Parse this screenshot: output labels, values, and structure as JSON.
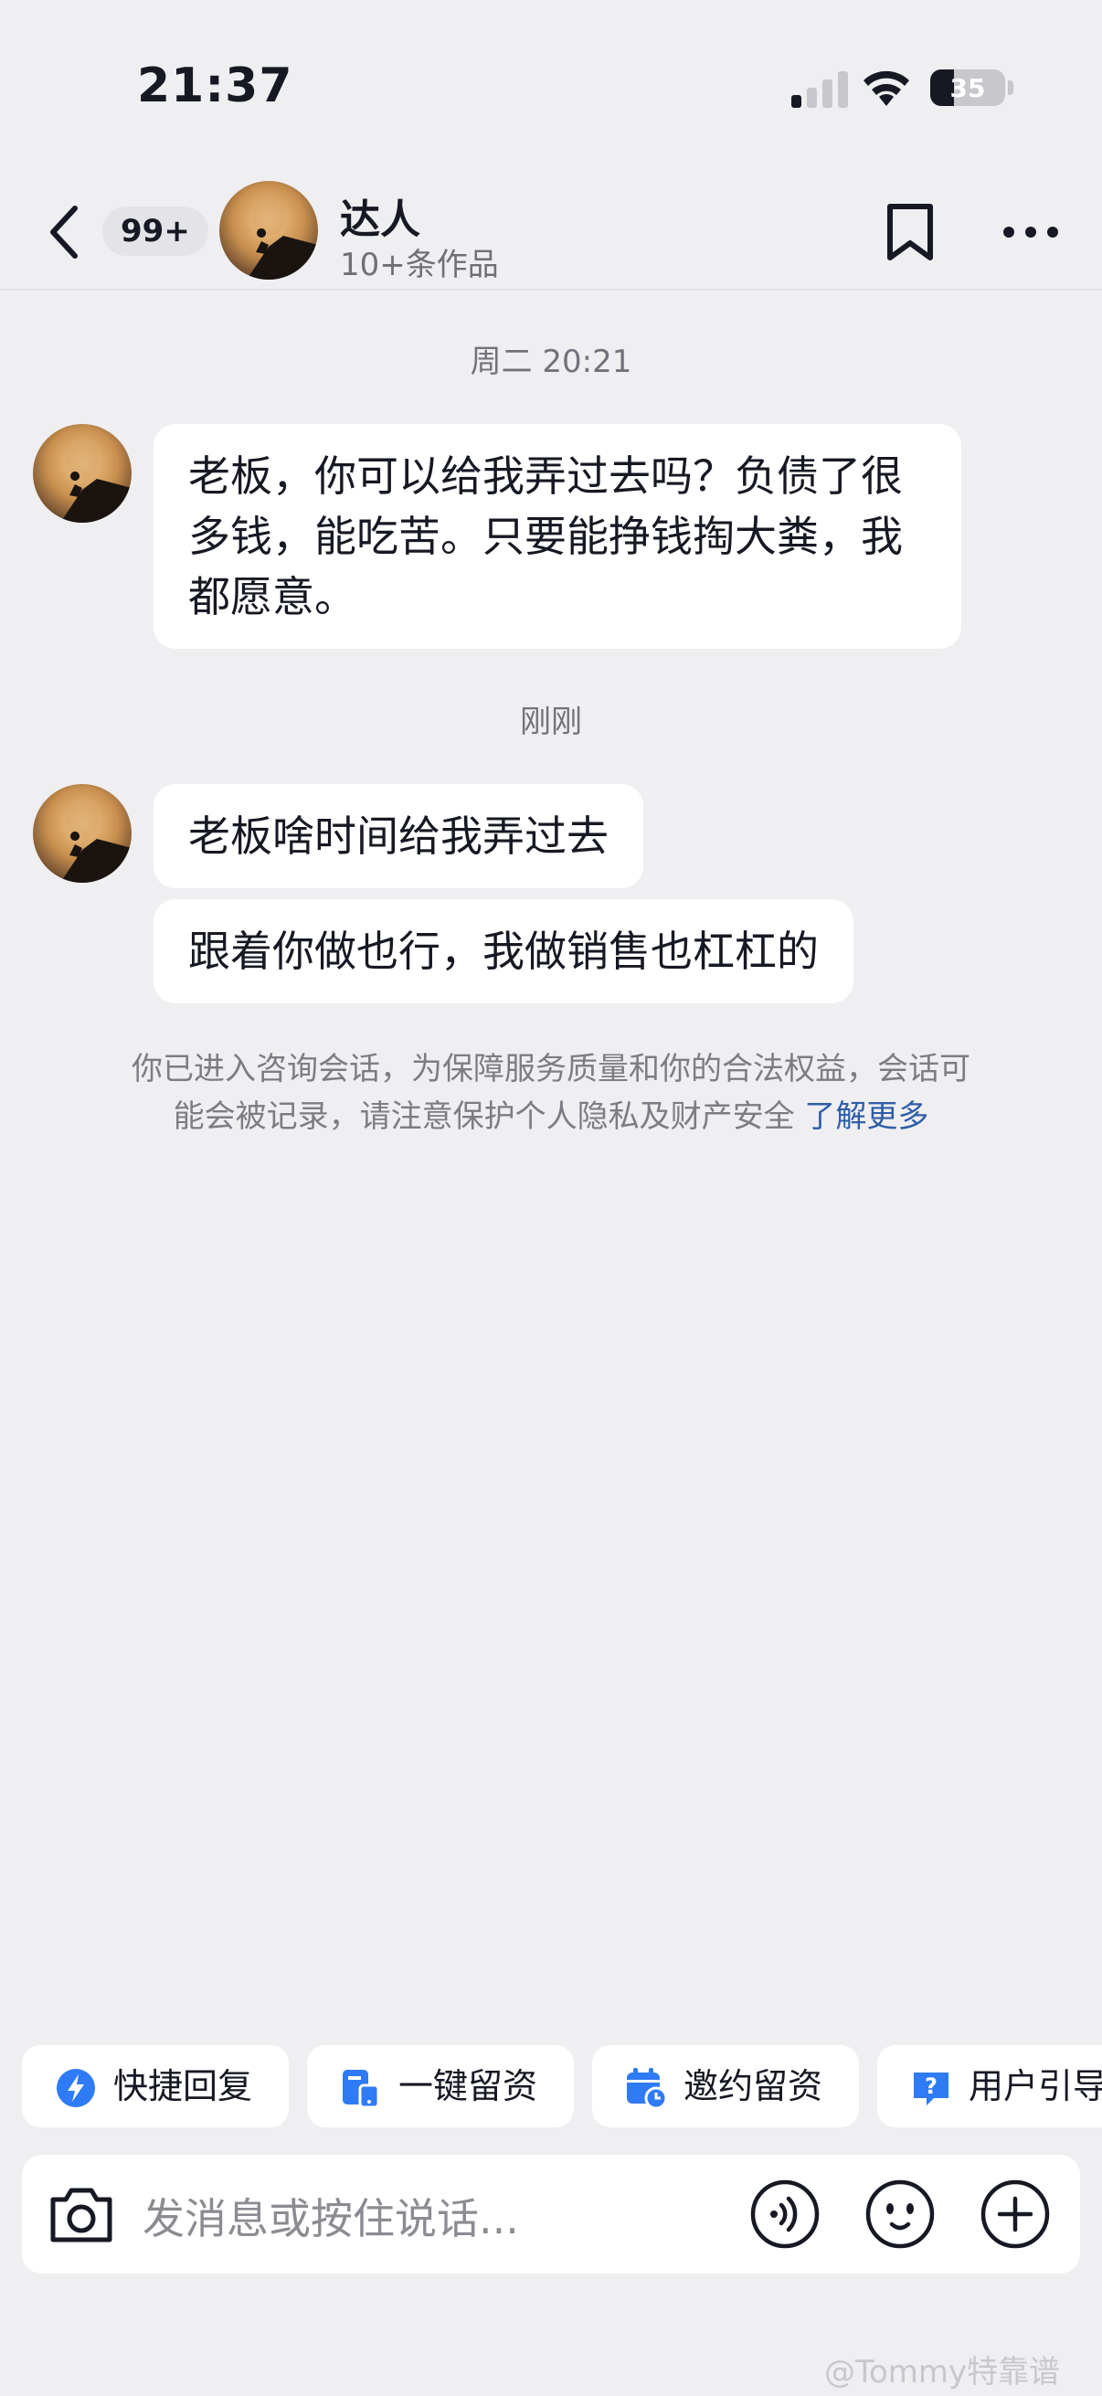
{
  "status_bar": {
    "time": "21:37",
    "battery": "35",
    "icons": [
      "cellular-signal-icon",
      "wifi-icon",
      "battery-icon"
    ]
  },
  "header": {
    "back_icon": "chevron-left-icon",
    "unread_count": "99+",
    "name": "达人",
    "subtitle": "10+条作品",
    "icons": [
      "bookmark-icon",
      "more-icon"
    ]
  },
  "messages": [
    {
      "timestamp": "周二 20:21"
    },
    {
      "text": "老板，你可以给我弄过去吗？负债了很多钱，能吃苦。只要能挣钱掏大粪，我都愿意。"
    },
    {
      "timestamp": "刚刚"
    },
    {
      "text": "老板啥时间给我弄过去"
    },
    {
      "text": "跟着你做也行，我做销售也杠杠的"
    }
  ],
  "notice": {
    "text": "你已进入咨询会话，为保障服务质量和你的合法权益，会话可能会被记录，请注意保护个人隐私及财产安全",
    "link": "了解更多"
  },
  "quick_actions": [
    {
      "label": "快捷回复",
      "icon": "lightning-icon",
      "color": "#2f7bf5"
    },
    {
      "label": "一键留资",
      "icon": "form-phone-icon",
      "color": "#2f7bf5"
    },
    {
      "label": "邀约留资",
      "icon": "calendar-clock-icon",
      "color": "#2f7bf5"
    },
    {
      "label": "用户引导",
      "icon": "question-icon",
      "color": "#2f7bf5"
    }
  ],
  "input": {
    "placeholder": "发消息或按住说话...",
    "icons": [
      "camera-icon",
      "voice-icon",
      "emoji-icon",
      "plus-icon"
    ]
  },
  "watermark": "@Tommy特靠谱"
}
